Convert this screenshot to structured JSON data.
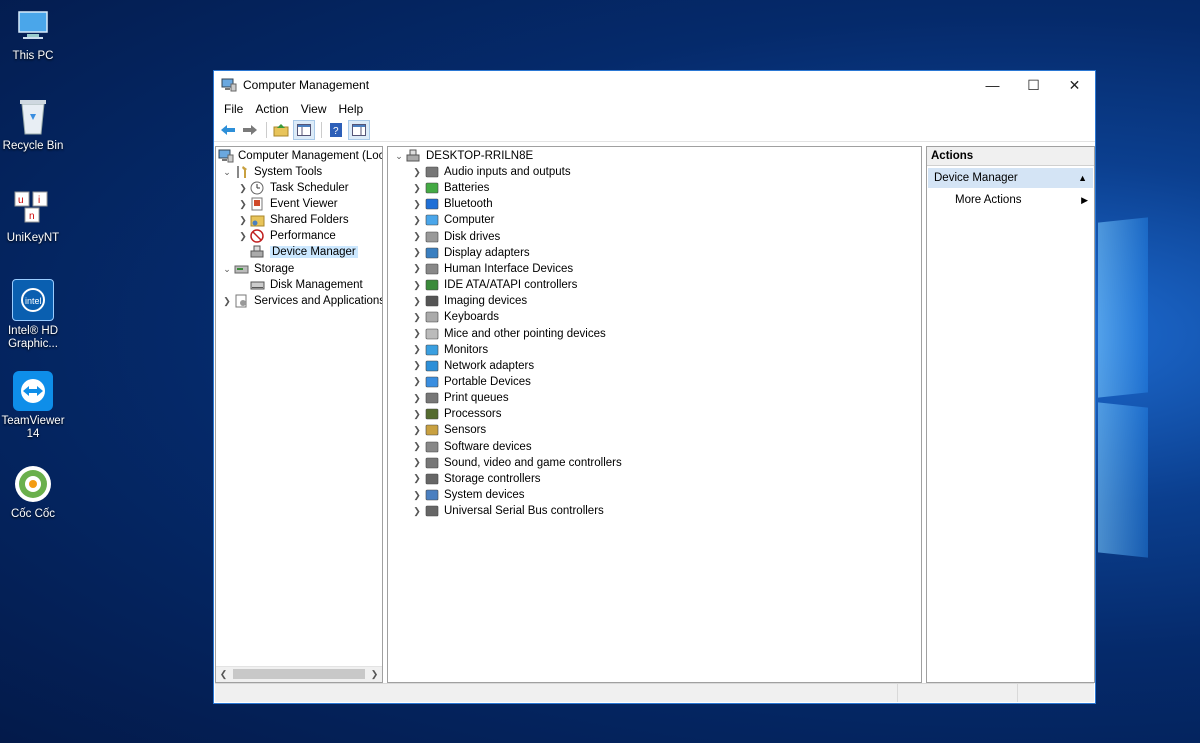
{
  "desktop": {
    "icons": [
      {
        "label": "This PC",
        "icon": "this-pc-icon"
      },
      {
        "label": "Recycle Bin",
        "icon": "recycle-bin-icon"
      },
      {
        "label": "UniKeyNT",
        "icon": "unikey-icon"
      },
      {
        "label": "Intel® HD Graphic...",
        "icon": "intel-graphics-icon"
      },
      {
        "label": "TeamViewer 14",
        "icon": "teamviewer-icon"
      },
      {
        "label": "Cốc Cốc",
        "icon": "coccoc-icon"
      }
    ]
  },
  "window": {
    "title": "Computer Management",
    "controls": {
      "minimize": "—",
      "maximize": "☐",
      "close": "✕"
    }
  },
  "menubar": [
    "File",
    "Action",
    "View",
    "Help"
  ],
  "toolbar": [
    "back-icon",
    "forward-icon",
    "up-folder-icon",
    "show-hide-tree-icon",
    "help-icon",
    "properties-icon"
  ],
  "left_tree": [
    {
      "label": "Computer Management (Local",
      "level": 0,
      "expander": ""
    },
    {
      "label": "System Tools",
      "level": 1,
      "expander": "v"
    },
    {
      "label": "Task Scheduler",
      "level": 2,
      "expander": ">"
    },
    {
      "label": "Event Viewer",
      "level": 2,
      "expander": ">"
    },
    {
      "label": "Shared Folders",
      "level": 2,
      "expander": ">"
    },
    {
      "label": "Performance",
      "level": 2,
      "expander": ">"
    },
    {
      "label": "Device Manager",
      "level": 2,
      "expander": "",
      "selected": true
    },
    {
      "label": "Storage",
      "level": 1,
      "expander": "v"
    },
    {
      "label": "Disk Management",
      "level": 2,
      "expander": ""
    },
    {
      "label": "Services and Applications",
      "level": 1,
      "expander": ">"
    }
  ],
  "device_tree": {
    "root": "DESKTOP-RRILN8E",
    "categories": [
      "Audio inputs and outputs",
      "Batteries",
      "Bluetooth",
      "Computer",
      "Disk drives",
      "Display adapters",
      "Human Interface Devices",
      "IDE ATA/ATAPI controllers",
      "Imaging devices",
      "Keyboards",
      "Mice and other pointing devices",
      "Monitors",
      "Network adapters",
      "Portable Devices",
      "Print queues",
      "Processors",
      "Sensors",
      "Software devices",
      "Sound, video and game controllers",
      "Storage controllers",
      "System devices",
      "Universal Serial Bus controllers"
    ]
  },
  "actions": {
    "header": "Actions",
    "section": "Device Manager",
    "items": [
      "More Actions"
    ]
  }
}
